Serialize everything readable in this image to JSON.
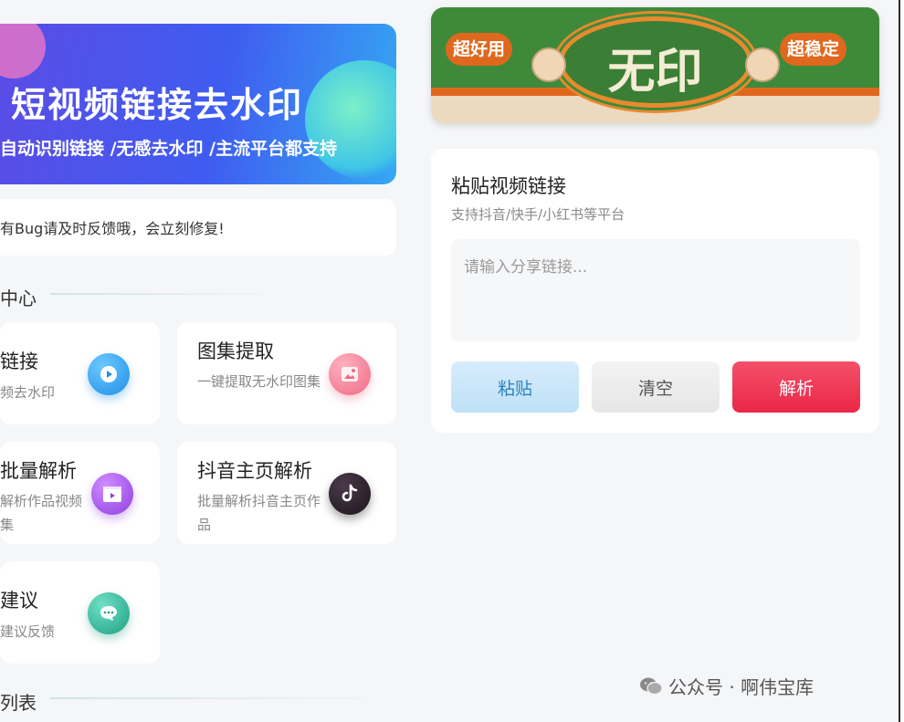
{
  "banner": {
    "title": "短视频链接去水印",
    "subtitle": "自动识别链接 /无感去水印 /主流平台都支持"
  },
  "notice": {
    "text": "有Bug请及时反馈哦，会立刻修复!"
  },
  "sections": {
    "tools": "中心",
    "list": "列表"
  },
  "cards": [
    {
      "title": "链接",
      "desc": "频去水印",
      "icon": "play-icon",
      "color": "#2f9bea"
    },
    {
      "title": "图集提取",
      "desc": "一键提取无水印图集",
      "icon": "image-icon",
      "color": "#f2758e"
    },
    {
      "title": "批量解析",
      "desc": "解析作品视频集",
      "icon": "video-clapper-icon",
      "color": "#a24fe0"
    },
    {
      "title": "抖音主页解析",
      "desc": "批量解析抖音主页作品",
      "icon": "tiktok-icon",
      "color": "#2a1f2a"
    },
    {
      "title": "建议",
      "desc": "建议反馈",
      "icon": "chat-icon",
      "color": "#23a889"
    }
  ],
  "right_banner": {
    "title": "无印",
    "left_pill": "超好用",
    "right_pill": "超稳定"
  },
  "panel": {
    "title": "粘贴视频链接",
    "subtitle": "支持抖音/快手/小红书等平台",
    "input_placeholder": "请输入分享链接...",
    "input_value": "",
    "paste_label": "粘贴",
    "clear_label": "清空",
    "parse_label": "解析"
  },
  "watermark": {
    "text": "公众号 · 啊伟宝库"
  }
}
